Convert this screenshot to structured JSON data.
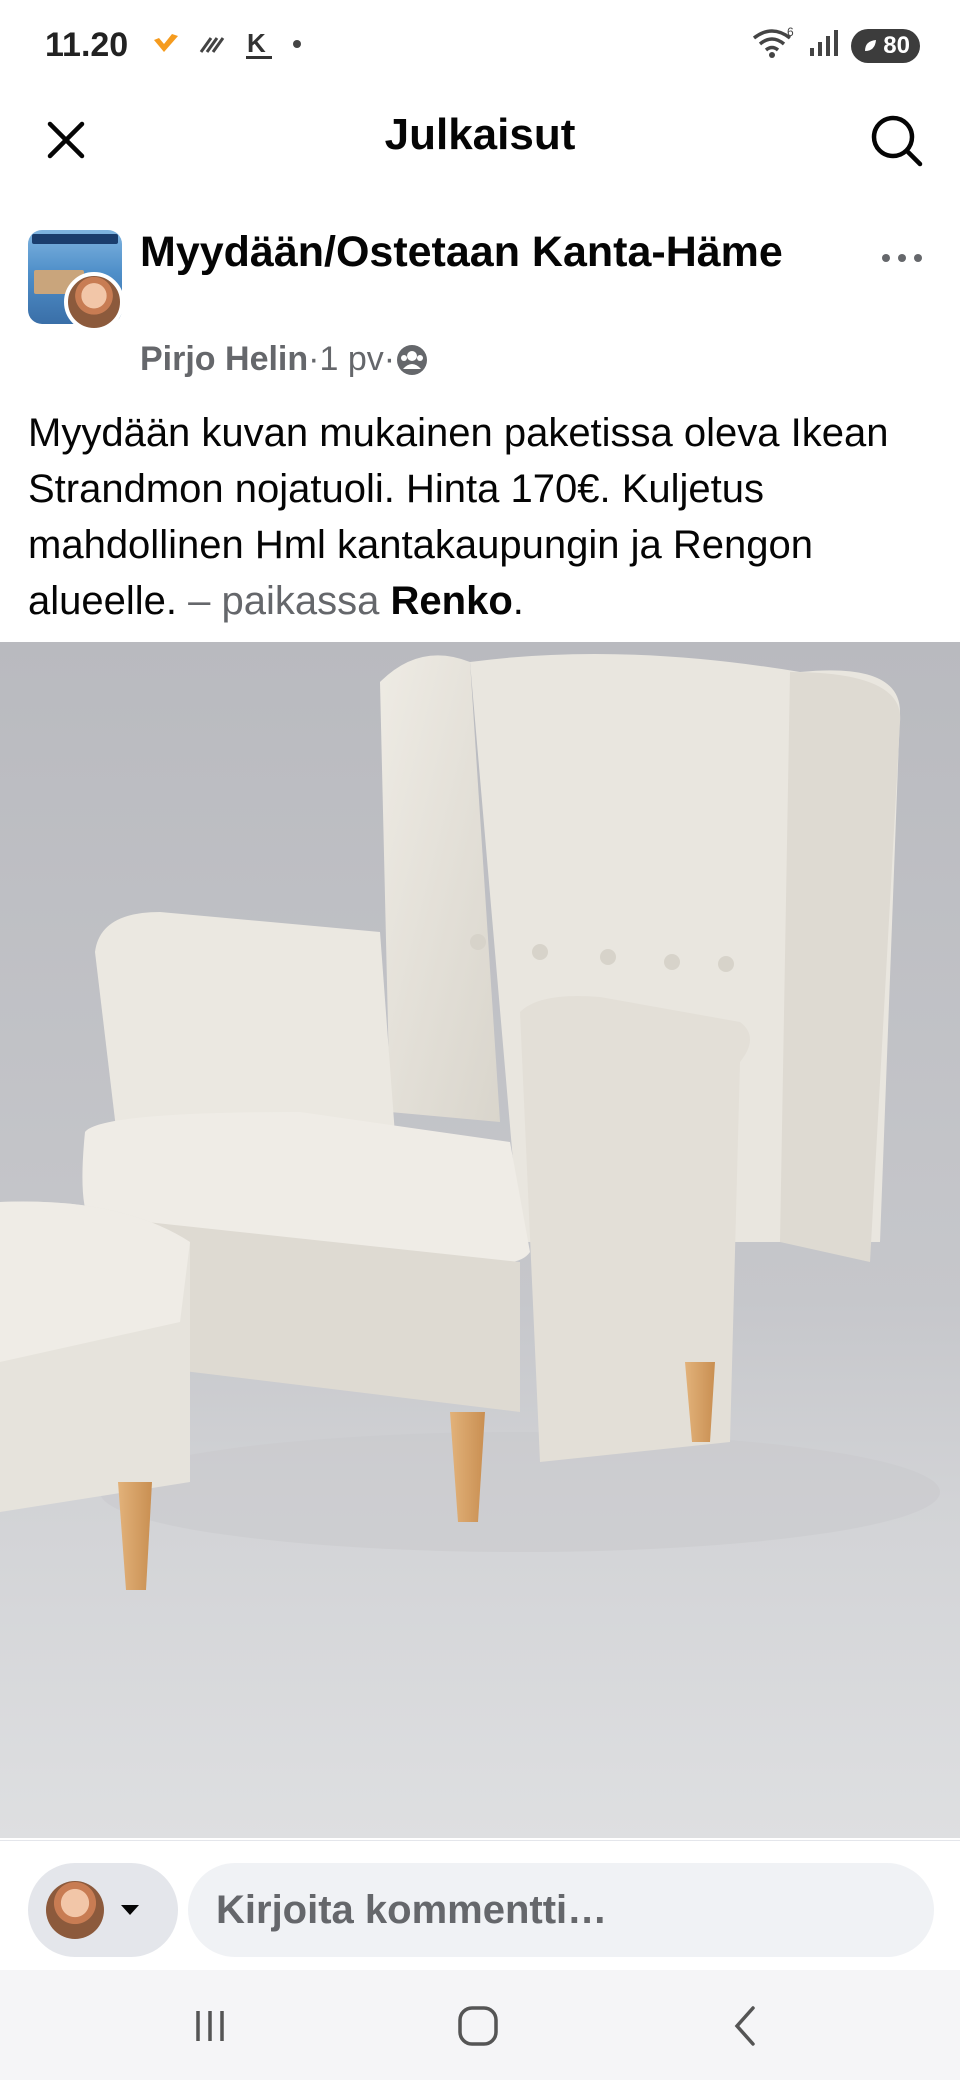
{
  "status_bar": {
    "time": "11.20",
    "left_icons": [
      "vpn-heart-icon",
      "nfc-icon",
      "k-app-icon",
      "notification-dot-icon"
    ],
    "right_icons": [
      "wifi-icon",
      "signal-icon",
      "battery-icon"
    ],
    "battery_level": "80"
  },
  "header": {
    "title": "Julkaisut",
    "close_icon": "close-icon",
    "search_icon": "search-icon"
  },
  "post": {
    "group_name": "Myydään/Ostetaan Kanta-Häme",
    "author": "Pirjo Helin",
    "separator": " · ",
    "age": "1 pv",
    "privacy_icon": "group-members-icon",
    "body": "Myydään kuvan mukainen paketissa oleva Ikean Strandmon nojatuoli. Hinta 170€. Kuljetus mahdollinen Hml kantakaupungin ja Rengon alueelle.",
    "location_prefix": "– paikassa",
    "location": "Renko",
    "location_suffix": "."
  },
  "comment_bar": {
    "placeholder": "Kirjoita kommentti…"
  },
  "nav_bar": {
    "buttons": [
      "recent-apps-icon",
      "home-icon",
      "back-icon"
    ]
  },
  "colors": {
    "text": "#050505",
    "muted": "#65676b",
    "input_bg": "#f0f2f5",
    "chair": "#e6e3dc"
  }
}
